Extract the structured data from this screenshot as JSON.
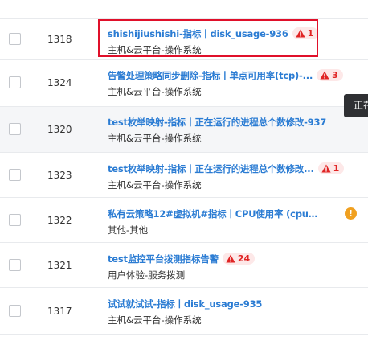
{
  "rows": [
    {
      "id": "1318",
      "title": "shishijiushishi-指标丨disk_usage-936",
      "subtitle": "主机&云平台-操作系统",
      "badge": "1"
    },
    {
      "id": "1324",
      "title": "告警处理策略同步删除-指标丨单点可用率(tcp)-...",
      "subtitle": "主机&云平台-操作系统",
      "badge": "3"
    },
    {
      "id": "1320",
      "title": "test枚举映射-指标丨正在运行的进程总个数修改-937",
      "subtitle": "主机&云平台-操作系统",
      "badge": ""
    },
    {
      "id": "1323",
      "title": "test枚举映射-指标丨正在运行的进程总个数修改...",
      "subtitle": "主机&云平台-操作系统",
      "badge": "1"
    },
    {
      "id": "1322",
      "title": "私有云策略12#虚拟机#指标丨CPU使用率 (cpu_usa...",
      "subtitle": "其他-其他",
      "badge": ""
    },
    {
      "id": "1321",
      "title": "test监控平台拨测指标告警",
      "subtitle": "用户体验-服务拨测",
      "badge": "24"
    },
    {
      "id": "1317",
      "title": "试试就试试-指标丨disk_usage-935",
      "subtitle": "主机&云平台-操作系统",
      "badge": ""
    }
  ],
  "tooltip": "正在",
  "warn_glyph": "!",
  "colors": {
    "link": "#2b7cd3",
    "alert_bg": "#fde8e8",
    "alert_fg": "#e02424",
    "warning": "#f0a020",
    "highlight": "#e0102a"
  }
}
